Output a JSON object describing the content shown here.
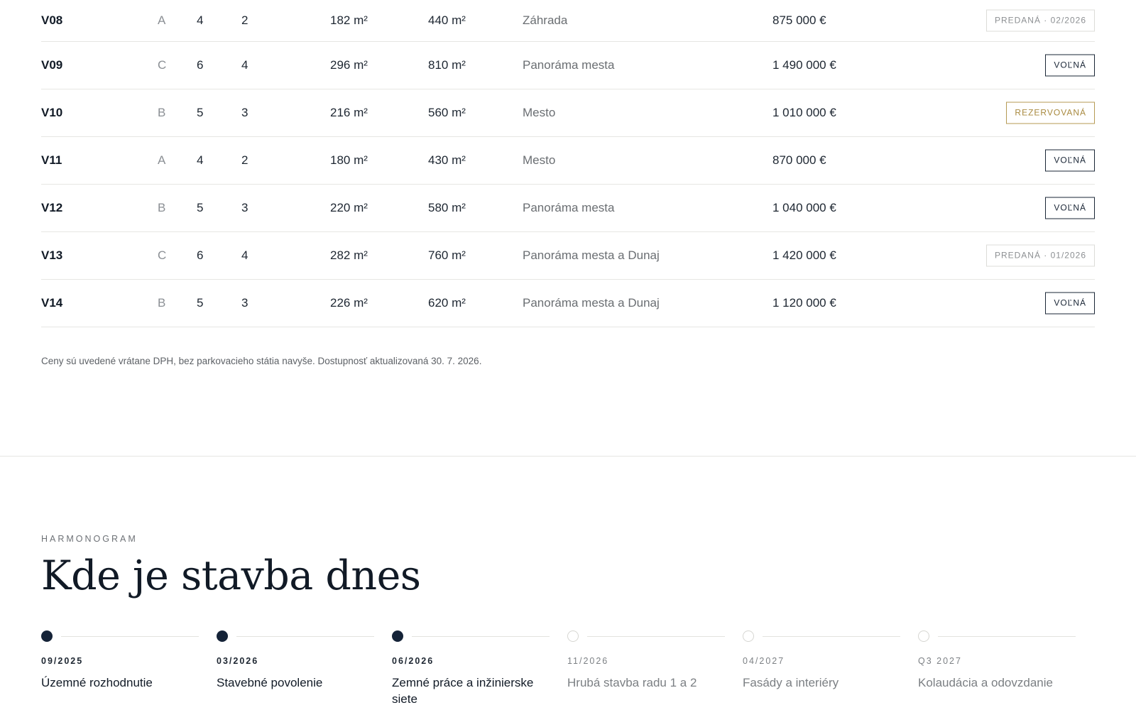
{
  "units": [
    {
      "id": "V08",
      "type": "A",
      "rooms": "4",
      "baths": "2",
      "area": "182 m²",
      "plot": "440 m²",
      "view": "Záhrada",
      "price": "875 000 €",
      "status": "PREDANÁ · 02/2026",
      "status_kind": "sold"
    },
    {
      "id": "V09",
      "type": "C",
      "rooms": "6",
      "baths": "4",
      "area": "296 m²",
      "plot": "810 m²",
      "view": "Panoráma mesta",
      "price": "1 490 000 €",
      "status": "VOĽNÁ",
      "status_kind": "available"
    },
    {
      "id": "V10",
      "type": "B",
      "rooms": "5",
      "baths": "3",
      "area": "216 m²",
      "plot": "560 m²",
      "view": "Mesto",
      "price": "1 010 000 €",
      "status": "REZERVOVANÁ",
      "status_kind": "reserved"
    },
    {
      "id": "V11",
      "type": "A",
      "rooms": "4",
      "baths": "2",
      "area": "180 m²",
      "plot": "430 m²",
      "view": "Mesto",
      "price": "870 000 €",
      "status": "VOĽNÁ",
      "status_kind": "available"
    },
    {
      "id": "V12",
      "type": "B",
      "rooms": "5",
      "baths": "3",
      "area": "220 m²",
      "plot": "580 m²",
      "view": "Panoráma mesta",
      "price": "1 040 000 €",
      "status": "VOĽNÁ",
      "status_kind": "available"
    },
    {
      "id": "V13",
      "type": "C",
      "rooms": "6",
      "baths": "4",
      "area": "282 m²",
      "plot": "760 m²",
      "view": "Panoráma mesta a Dunaj",
      "price": "1 420 000 €",
      "status": "PREDANÁ · 01/2026",
      "status_kind": "sold"
    },
    {
      "id": "V14",
      "type": "B",
      "rooms": "5",
      "baths": "3",
      "area": "226 m²",
      "plot": "620 m²",
      "view": "Panoráma mesta a Dunaj",
      "price": "1 120 000 €",
      "status": "VOĽNÁ",
      "status_kind": "available"
    }
  ],
  "note": "Ceny sú uvedené vrátane DPH, bez parkovacieho státia navyše. Dostupnosť aktualizovaná 30. 7. 2026.",
  "schedule": {
    "eyebrow": "HARMONOGRAM",
    "heading": "Kde je stavba dnes",
    "steps": [
      {
        "date": "09/2025",
        "label": "Územné rozhodnutie",
        "done": true
      },
      {
        "date": "03/2026",
        "label": "Stavebné povolenie",
        "done": true
      },
      {
        "date": "06/2026",
        "label": "Zemné práce a inžinierske siete",
        "done": true
      },
      {
        "date": "11/2026",
        "label": "Hrubá stavba radu 1 a 2",
        "done": false
      },
      {
        "date": "04/2027",
        "label": "Fasády a interiéry",
        "done": false
      },
      {
        "date": "Q3 2027",
        "label": "Kolaudácia a odovzdanie",
        "done": false
      }
    ]
  },
  "colors": {
    "navy": "#152338",
    "gold": "#b59a53",
    "muted": "#8b8f94"
  }
}
